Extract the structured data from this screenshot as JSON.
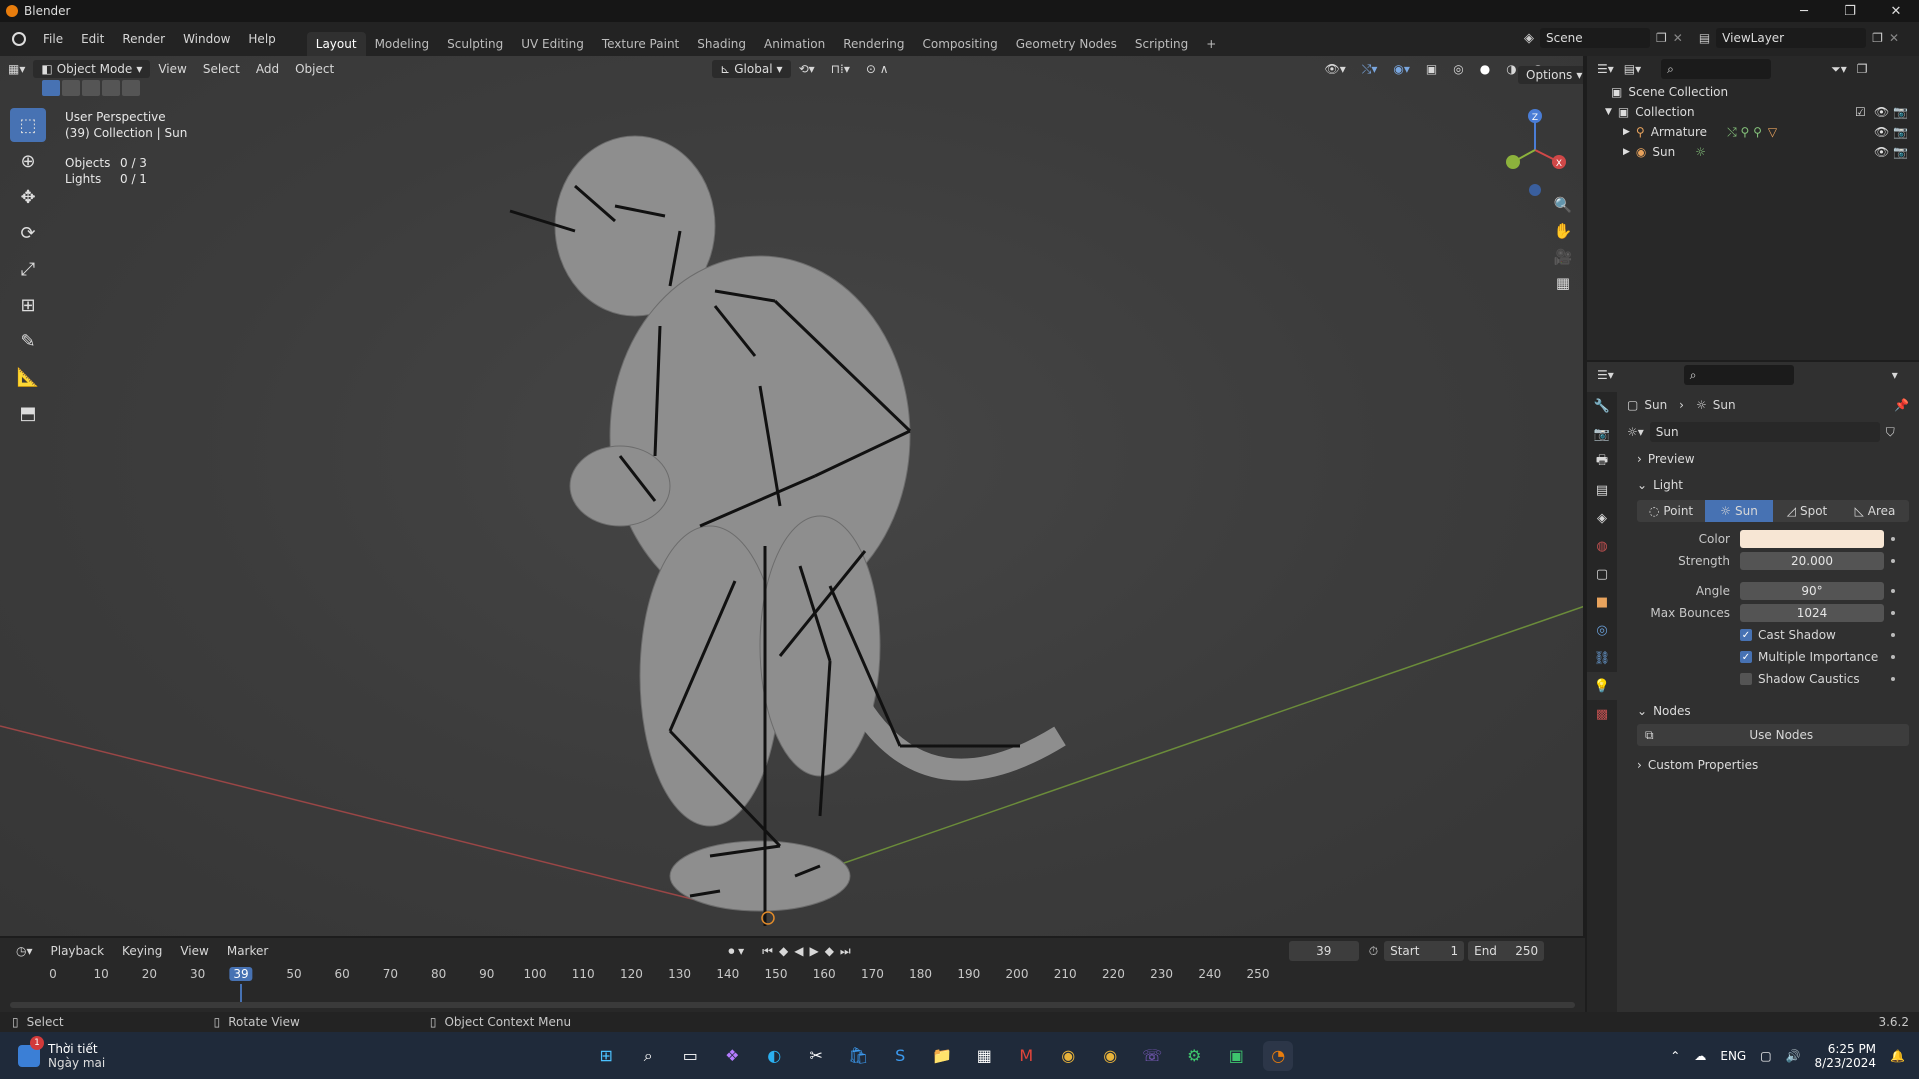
{
  "window": {
    "title": "Blender",
    "minimize": "─",
    "maximize": "❐",
    "close": "✕"
  },
  "menu": [
    "File",
    "Edit",
    "Render",
    "Window",
    "Help"
  ],
  "workspaces": [
    "Layout",
    "Modeling",
    "Sculpting",
    "UV Editing",
    "Texture Paint",
    "Shading",
    "Animation",
    "Rendering",
    "Compositing",
    "Geometry Nodes",
    "Scripting"
  ],
  "add_workspace": "+",
  "scene": "Scene",
  "view_layer": "ViewLayer",
  "viewport": {
    "mode": "Object Mode",
    "menus": [
      "View",
      "Select",
      "Add",
      "Object"
    ],
    "transform_orientation": "Global",
    "options": "Options",
    "overlay_title": "User Perspective",
    "overlay_subtitle": "(39) Collection | Sun",
    "objects_label": "Objects",
    "objects_value": "0 / 3",
    "lights_label": "Lights",
    "lights_value": "0 / 1",
    "axis_x": "X",
    "axis_y": "Y",
    "axis_z": "Z"
  },
  "outliner": {
    "scene_collection": "Scene Collection",
    "collection": "Collection",
    "items": [
      "Armature",
      "Sun"
    ]
  },
  "properties": {
    "breadcrumb_object": "Sun",
    "breadcrumb_data": "Sun",
    "datablock": "Sun",
    "panel_preview": "Preview",
    "panel_light": "Light",
    "light_types": [
      "Point",
      "Sun",
      "Spot",
      "Area"
    ],
    "active_light_type": "Sun",
    "color_label": "Color",
    "color_value": "#f7e6d4",
    "strength_label": "Strength",
    "strength_value": "20.000",
    "angle_label": "Angle",
    "angle_value": "90°",
    "max_bounces_label": "Max Bounces",
    "max_bounces_value": "1024",
    "cast_shadow": "Cast Shadow",
    "multiple_importance": "Multiple Importance",
    "shadow_caustics": "Shadow Caustics",
    "panel_nodes": "Nodes",
    "use_nodes": "Use Nodes",
    "panel_custom": "Custom Properties"
  },
  "timeline": {
    "menus": [
      "Playback",
      "Keying",
      "View",
      "Marker"
    ],
    "current_frame": "39",
    "start_label": "Start",
    "start_value": "1",
    "end_label": "End",
    "end_value": "250",
    "ruler": [
      "0",
      "10",
      "20",
      "30",
      "39",
      "50",
      "60",
      "70",
      "80",
      "90",
      "100",
      "110",
      "120",
      "130",
      "140",
      "150",
      "160",
      "170",
      "180",
      "190",
      "200",
      "210",
      "220",
      "230",
      "240",
      "250"
    ]
  },
  "statusbar": {
    "select": "Select",
    "rotate": "Rotate View",
    "context": "Object Context Menu",
    "version": "3.6.2"
  },
  "taskbar": {
    "weather_title": "Thời tiết",
    "weather_sub": "Ngày mai",
    "badge": "1",
    "lang": "ENG",
    "time": "6:25 PM",
    "date": "8/23/2024"
  },
  "colors": {
    "accent": "#4772b3",
    "orange": "#e87d0d"
  }
}
